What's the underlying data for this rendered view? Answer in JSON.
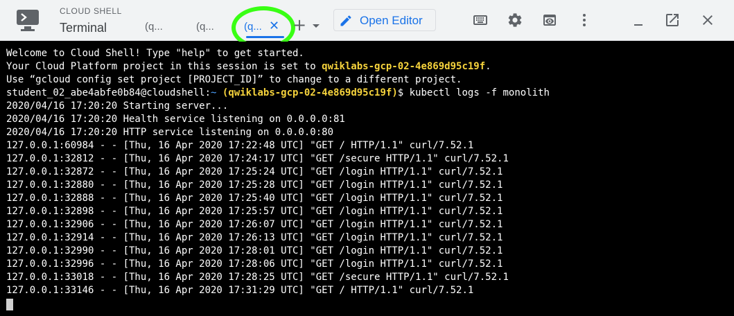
{
  "header": {
    "app_label": "CLOUD SHELL",
    "app_title": "Terminal",
    "tabs": [
      {
        "label": "(q..."
      },
      {
        "label": "(q..."
      },
      {
        "label": "(q...",
        "active": true
      }
    ],
    "open_editor_label": "Open Editor",
    "accent_color": "#1a73e8",
    "highlight_color": "#39ff14"
  },
  "terminal": {
    "welcome": "Welcome to Cloud Shell! Type \"help\" to get started.",
    "project_line_prefix": "Your Cloud Platform project in this session is set to ",
    "project_id": "qwiklabs-gcp-02-4e869d95c19f",
    "project_line_suffix": ".",
    "config_hint": "Use “gcloud config set project [PROJECT_ID]” to change to a different project.",
    "prompt_user": "student_02_abe4abfe0b84@cloudshell:",
    "prompt_path": "~",
    "prompt_project": "(qwiklabs-gcp-02-4e869d95c19f)",
    "prompt_symbol": "$ ",
    "command": "kubectl logs -f monolith",
    "output": [
      "2020/04/16 17:20:20 Starting server...",
      "2020/04/16 17:20:20 Health service listening on 0.0.0.0:81",
      "2020/04/16 17:20:20 HTTP service listening on 0.0.0.0:80",
      "127.0.0.1:60984 - - [Thu, 16 Apr 2020 17:22:48 UTC] \"GET / HTTP/1.1\" curl/7.52.1",
      "127.0.0.1:32812 - - [Thu, 16 Apr 2020 17:24:17 UTC] \"GET /secure HTTP/1.1\" curl/7.52.1",
      "127.0.0.1:32872 - - [Thu, 16 Apr 2020 17:25:24 UTC] \"GET /login HTTP/1.1\" curl/7.52.1",
      "127.0.0.1:32880 - - [Thu, 16 Apr 2020 17:25:28 UTC] \"GET /login HTTP/1.1\" curl/7.52.1",
      "127.0.0.1:32888 - - [Thu, 16 Apr 2020 17:25:40 UTC] \"GET /login HTTP/1.1\" curl/7.52.1",
      "127.0.0.1:32898 - - [Thu, 16 Apr 2020 17:25:57 UTC] \"GET /login HTTP/1.1\" curl/7.52.1",
      "127.0.0.1:32906 - - [Thu, 16 Apr 2020 17:26:07 UTC] \"GET /login HTTP/1.1\" curl/7.52.1",
      "127.0.0.1:32914 - - [Thu, 16 Apr 2020 17:26:13 UTC] \"GET /login HTTP/1.1\" curl/7.52.1",
      "127.0.0.1:32990 - - [Thu, 16 Apr 2020 17:28:01 UTC] \"GET /login HTTP/1.1\" curl/7.52.1",
      "127.0.0.1:32996 - - [Thu, 16 Apr 2020 17:28:06 UTC] \"GET /login HTTP/1.1\" curl/7.52.1",
      "127.0.0.1:33018 - - [Thu, 16 Apr 2020 17:28:25 UTC] \"GET /secure HTTP/1.1\" curl/7.52.1",
      "127.0.0.1:33146 - - [Thu, 16 Apr 2020 17:31:29 UTC] \"GET / HTTP/1.1\" curl/7.52.1"
    ],
    "prompt_color": "#f6d33c"
  },
  "icons": {
    "app": "cloud-shell-terminal-icon",
    "pencil": "pencil-icon",
    "keyboard": "keyboard-icon",
    "settings": "gear-icon",
    "web_preview": "web-preview-icon",
    "more": "more-vert-icon",
    "minimize": "minimize-icon",
    "open_new_window": "open-in-new-window-icon",
    "close": "close-icon"
  }
}
